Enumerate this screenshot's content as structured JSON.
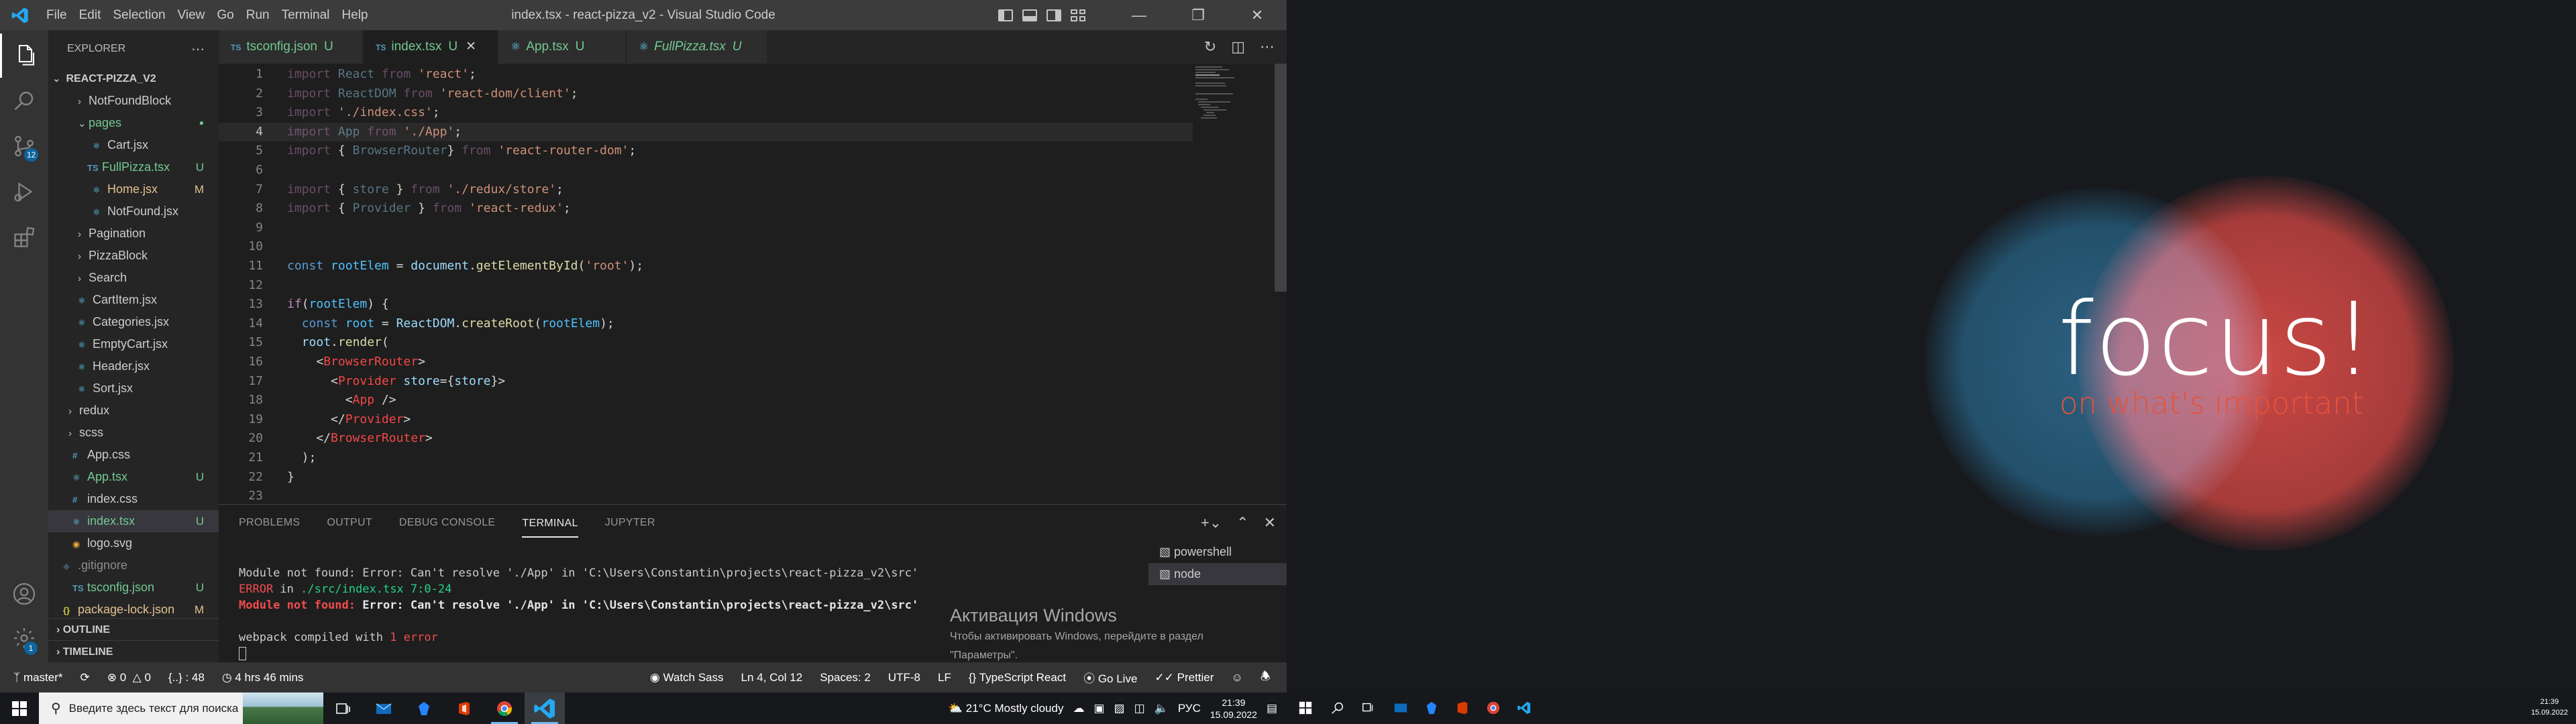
{
  "window": {
    "title": "index.tsx - react-pizza_v2 - Visual Studio Code",
    "menu": [
      "File",
      "Edit",
      "Selection",
      "View",
      "Go",
      "Run",
      "Terminal",
      "Help"
    ]
  },
  "activity": {
    "scm_badge": "12",
    "settings_badge": "1"
  },
  "explorer": {
    "title": "EXPLORER",
    "root": "REACT-PIZZA_V2",
    "items": [
      {
        "name": "NotFoundBlock",
        "status": ""
      },
      {
        "name": "pages",
        "status": "●"
      },
      {
        "name": "Cart.jsx",
        "status": ""
      },
      {
        "name": "FullPizza.tsx",
        "status": "U"
      },
      {
        "name": "Home.jsx",
        "status": "M"
      },
      {
        "name": "NotFound.jsx",
        "status": ""
      },
      {
        "name": "Pagination",
        "status": ""
      },
      {
        "name": "PizzaBlock",
        "status": ""
      },
      {
        "name": "Search",
        "status": ""
      },
      {
        "name": "CartItem.jsx",
        "status": ""
      },
      {
        "name": "Categories.jsx",
        "status": ""
      },
      {
        "name": "EmptyCart.jsx",
        "status": ""
      },
      {
        "name": "Header.jsx",
        "status": ""
      },
      {
        "name": "Sort.jsx",
        "status": ""
      },
      {
        "name": "redux",
        "status": ""
      },
      {
        "name": "scss",
        "status": ""
      },
      {
        "name": "App.css",
        "status": ""
      },
      {
        "name": "App.tsx",
        "status": "U"
      },
      {
        "name": "index.css",
        "status": ""
      },
      {
        "name": "index.tsx",
        "status": "U"
      },
      {
        "name": "logo.svg",
        "status": ""
      },
      {
        "name": ".gitignore",
        "status": ""
      },
      {
        "name": "tsconfig.json",
        "status": "U"
      },
      {
        "name": "package-lock.json",
        "status": "M"
      }
    ],
    "outline": "OUTLINE",
    "timeline": "TIMELINE"
  },
  "tabs": [
    {
      "icon": "TS",
      "label": "tsconfig.json",
      "status": "U"
    },
    {
      "icon": "TS",
      "label": "index.tsx",
      "status": "U"
    },
    {
      "icon": "⚛",
      "label": "App.tsx",
      "status": "U"
    },
    {
      "icon": "⚛",
      "label": "FullPizza.tsx",
      "status": "U"
    }
  ],
  "editor": {
    "line_numbers": [
      "1",
      "2",
      "3",
      "4",
      "5",
      "6",
      "7",
      "8",
      "9",
      "10",
      "11",
      "12",
      "13",
      "14",
      "15",
      "16",
      "17",
      "18",
      "19",
      "20",
      "21",
      "22",
      "23"
    ],
    "lines": [
      [
        [
          "kw",
          "import "
        ],
        [
          "id",
          "React"
        ],
        [
          "kw",
          " from "
        ],
        [
          "str",
          "'react'"
        ],
        [
          "p",
          ";"
        ]
      ],
      [
        [
          "kw",
          "import "
        ],
        [
          "id",
          "ReactDOM"
        ],
        [
          "kw",
          " from "
        ],
        [
          "str",
          "'react-dom/client'"
        ],
        [
          "p",
          ";"
        ]
      ],
      [
        [
          "kw",
          "import "
        ],
        [
          "str",
          "'./index.css'"
        ],
        [
          "p",
          ";"
        ]
      ],
      [
        [
          "kw",
          "import "
        ],
        [
          "id",
          "App"
        ],
        [
          "kw",
          " from "
        ],
        [
          "str",
          "'./App'"
        ],
        [
          "p",
          ";"
        ]
      ],
      [
        [
          "kw",
          "import "
        ],
        [
          "p",
          "{ "
        ],
        [
          "id",
          "BrowserRouter"
        ],
        [
          "p",
          "} "
        ],
        [
          "kw",
          "from "
        ],
        [
          "str",
          "'react-router-dom'"
        ],
        [
          "p",
          ";"
        ]
      ],
      [],
      [
        [
          "kw",
          "import "
        ],
        [
          "p",
          "{ "
        ],
        [
          "id",
          "store"
        ],
        [
          "p",
          " } "
        ],
        [
          "kw",
          "from "
        ],
        [
          "str",
          "'./redux/store'"
        ],
        [
          "p",
          ";"
        ]
      ],
      [
        [
          "kw",
          "import "
        ],
        [
          "p",
          "{ "
        ],
        [
          "id",
          "Provider"
        ],
        [
          "p",
          " } "
        ],
        [
          "kw",
          "from "
        ],
        [
          "str",
          "'react-redux'"
        ],
        [
          "p",
          ";"
        ]
      ],
      [],
      [],
      [
        [
          "kw2",
          "const "
        ],
        [
          "const",
          "rootElem"
        ],
        [
          "p",
          " = "
        ],
        [
          "id",
          "document"
        ],
        [
          "p",
          "."
        ],
        [
          "fn",
          "getElementById"
        ],
        [
          "p",
          "("
        ],
        [
          "str",
          "'root'"
        ],
        [
          "p",
          ");"
        ]
      ],
      [],
      [
        [
          "kw",
          "if"
        ],
        [
          "p",
          "("
        ],
        [
          "const",
          "rootElem"
        ],
        [
          "p",
          ") {"
        ]
      ],
      [
        [
          "p",
          "  "
        ],
        [
          "kw2",
          "const "
        ],
        [
          "const",
          "root"
        ],
        [
          "p",
          " = "
        ],
        [
          "id",
          "ReactDOM"
        ],
        [
          "p",
          "."
        ],
        [
          "fn",
          "createRoot"
        ],
        [
          "p",
          "("
        ],
        [
          "const",
          "rootElem"
        ],
        [
          "p",
          ");"
        ]
      ],
      [
        [
          "p",
          "  "
        ],
        [
          "id",
          "root"
        ],
        [
          "p",
          "."
        ],
        [
          "fn",
          "render"
        ],
        [
          "p",
          "("
        ]
      ],
      [
        [
          "p",
          "    <"
        ],
        [
          "tag",
          "BrowserRouter"
        ],
        [
          "p",
          ">"
        ]
      ],
      [
        [
          "p",
          "      <"
        ],
        [
          "tag",
          "Provider"
        ],
        [
          "p",
          " "
        ],
        [
          "id",
          "store"
        ],
        [
          "p",
          "={"
        ],
        [
          "id",
          "store"
        ],
        [
          "p",
          "}>"
        ]
      ],
      [
        [
          "p",
          "        <"
        ],
        [
          "tag",
          "App"
        ],
        [
          "p",
          " />"
        ]
      ],
      [
        [
          "p",
          "      </"
        ],
        [
          "tag",
          "Provider"
        ],
        [
          "p",
          ">"
        ]
      ],
      [
        [
          "p",
          "    </"
        ],
        [
          "tag",
          "BrowserRouter"
        ],
        [
          "p",
          ">"
        ]
      ],
      [
        [
          "p",
          "  );"
        ]
      ],
      [
        [
          "p",
          "}"
        ]
      ],
      []
    ]
  },
  "panel": {
    "tabs": [
      "PROBLEMS",
      "OUTPUT",
      "DEBUG CONSOLE",
      "TERMINAL",
      "JUPYTER"
    ],
    "active_tab": "TERMINAL",
    "terminal": {
      "line1": "Module not found: Error: Can't resolve './App' in 'C:\\Users\\Constantin\\projects\\react-pizza_v2\\src'",
      "line2_red": "ERROR",
      "line2_mid": " in ",
      "line2_green": "./src/index.tsx 7:0-24",
      "line3_red": "Module not found:",
      "line3_rest": " Error: Can't resolve './App' in 'C:\\Users\\Constantin\\projects\\react-pizza_v2\\src'",
      "line4_a": "webpack compiled with ",
      "line4_b": "1 error"
    },
    "terminals": [
      "powershell",
      "node"
    ],
    "activation_title": "Активация Windows",
    "activation_text1": "Чтобы активировать Windows, перейдите в раздел",
    "activation_text2": "\"Параметры\"."
  },
  "status": {
    "branch": "master*",
    "errors": "0",
    "warnings": "0",
    "position": "{..} : 48",
    "time": "4 hrs 46 mins",
    "watch": "Watch Sass",
    "cursor": "Ln 4, Col 12",
    "spaces": "Spaces: 2",
    "encoding": "UTF-8",
    "eol": "LF",
    "language": "TypeScript React",
    "golive": "Go Live",
    "prettier": "Prettier"
  },
  "taskbar": {
    "search_placeholder": "Введите здесь текст для поиска",
    "weather": "21°C  Mostly cloudy",
    "lang": "РУС",
    "time": "21:39",
    "date": "15.09.2022"
  },
  "wallpaper": {
    "title": "focus!",
    "subtitle": "on what's important"
  },
  "taskbar2": {
    "time": "21:39",
    "date": "15.09.2022"
  },
  "colors": {
    "accent": "#007acc",
    "untracked": "#73c991",
    "modified": "#e2c08d"
  }
}
